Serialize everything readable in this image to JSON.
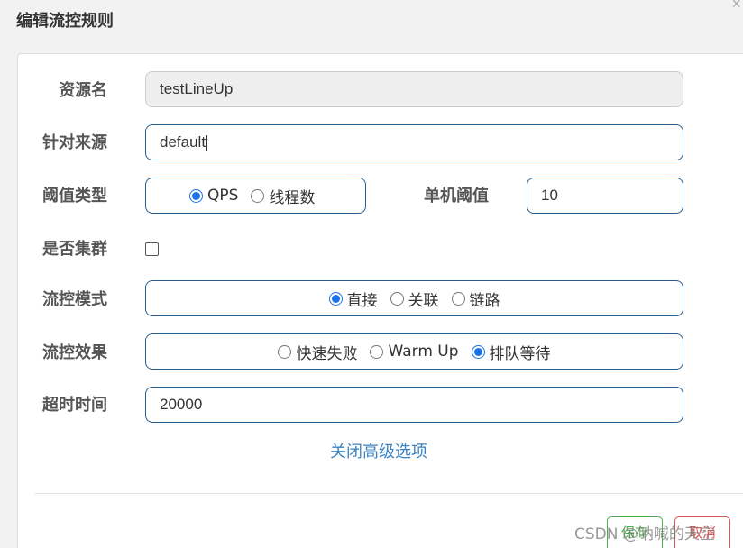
{
  "dialog": {
    "title": "编辑流控规则"
  },
  "form": {
    "resource": {
      "label": "资源名",
      "value": "testLineUp"
    },
    "limit_app": {
      "label": "针对来源",
      "value": "default"
    },
    "grade": {
      "label": "阈值类型",
      "options": [
        "QPS",
        "线程数"
      ],
      "selected": "QPS"
    },
    "threshold": {
      "label": "单机阈值",
      "value": "10"
    },
    "cluster": {
      "label": "是否集群",
      "checked": false
    },
    "strategy": {
      "label": "流控模式",
      "options": [
        "直接",
        "关联",
        "链路"
      ],
      "selected": "直接"
    },
    "control_behavior": {
      "label": "流控效果",
      "options": [
        "快速失败",
        "Warm Up",
        "排队等待"
      ],
      "selected": "排队等待"
    },
    "timeout": {
      "label": "超时时间",
      "value": "20000"
    }
  },
  "advanced_link": "关闭高级选项",
  "buttons": {
    "save": "保存",
    "cancel": "取消"
  },
  "watermark": "CSDN @呐喊的天空",
  "colors": {
    "accent": "#1a73e8",
    "border": "#2a5d8f",
    "link": "#3c84c0",
    "save": "#4cae4c",
    "cancel": "#d9534f"
  }
}
